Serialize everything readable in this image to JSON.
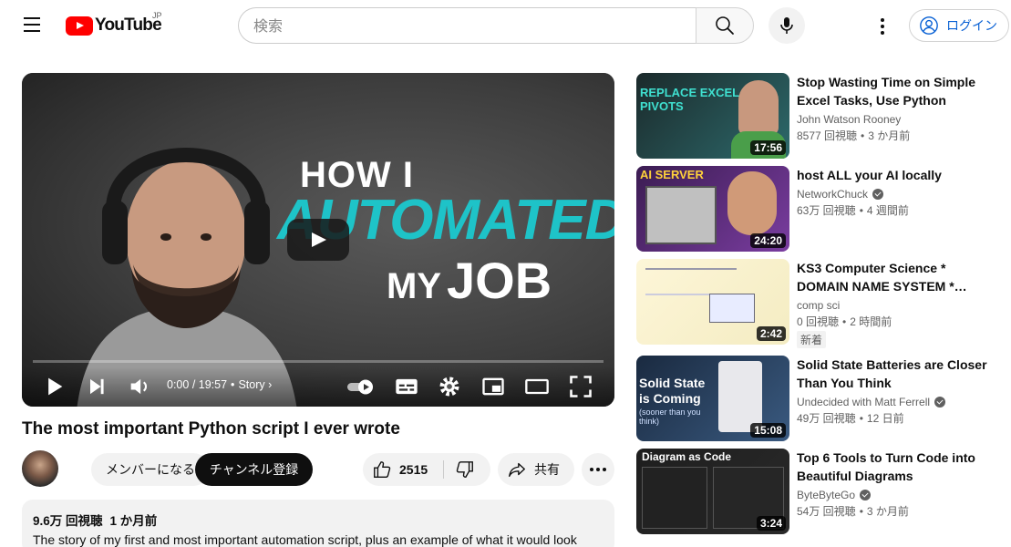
{
  "header": {
    "logo_text": "YouTube",
    "region": "JP",
    "search_placeholder": "検索",
    "login_label": "ログイン"
  },
  "player": {
    "title_art": {
      "line1": "HOW I",
      "line2": "AUTOMATED",
      "line3_small": "MY",
      "line3": "JOB"
    },
    "time_current": "0:00",
    "time_total": "19:57",
    "chapter": "Story",
    "progress": 0
  },
  "video": {
    "title": "The most important Python script I ever wrote",
    "member_label": "メンバーになる",
    "subscribe_label": "チャンネル登録",
    "like_count": "2515",
    "share_label": "共有",
    "views": "9.6万 回視聴",
    "age": "1 か月前",
    "description": "The story of my first and most important automation script, plus an example of what it would look"
  },
  "recommendations": [
    {
      "title": "Stop Wasting Time on Simple Excel Tasks, Use Python",
      "channel": "John Watson Rooney",
      "verified": false,
      "views": "8577 回視聴",
      "age": "3 か月前",
      "duration": "17:56",
      "thumb_text": "REPLACE EXCEL PIVOTS",
      "thumb_colors": [
        "#1b2a2b",
        "#2d6a6c"
      ]
    },
    {
      "title": "host ALL your AI locally",
      "channel": "NetworkChuck",
      "verified": true,
      "views": "63万 回視聴",
      "age": "4 週間前",
      "duration": "24:20",
      "thumb_text": "AI SERVER",
      "thumb_colors": [
        "#3b1c52",
        "#7a3da0"
      ]
    },
    {
      "title": "KS3 Computer Science * DOMAIN NAME SYSTEM *…",
      "channel": "comp sci",
      "verified": false,
      "views": "0 回視聴",
      "age": "2 時間前",
      "badge": "新着",
      "duration": "2:42",
      "thumb_text": "",
      "thumb_colors": [
        "#fdf6d8",
        "#f4ecc2"
      ]
    },
    {
      "title": "Solid State Batteries are Closer Than You Think",
      "channel": "Undecided with Matt Ferrell",
      "verified": true,
      "views": "49万 回視聴",
      "age": "12 日前",
      "duration": "15:08",
      "thumb_text": "Solid State is Coming",
      "thumb_sub": "(sooner than you think)",
      "thumb_colors": [
        "#1a2a40",
        "#3a5a80"
      ]
    },
    {
      "title": "Top 6 Tools to Turn Code into Beautiful Diagrams",
      "channel": "ByteByteGo",
      "verified": true,
      "views": "54万 回視聴",
      "age": "3 か月前",
      "duration": "3:24",
      "thumb_text": "Diagram as Code",
      "thumb_colors": [
        "#1e1e1e",
        "#2a2a2a"
      ]
    }
  ]
}
